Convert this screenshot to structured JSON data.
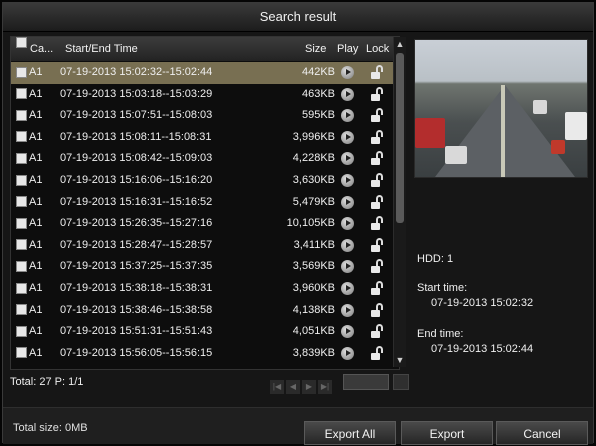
{
  "window": {
    "title": "Search result"
  },
  "table": {
    "columns": {
      "cam": "Ca...",
      "time": "Start/End Time",
      "size": "Size",
      "play": "Play",
      "lock": "Lock"
    },
    "rows": [
      {
        "cam": "A1",
        "time": "07-19-2013 15:02:32--15:02:44",
        "size": "442KB"
      },
      {
        "cam": "A1",
        "time": "07-19-2013 15:03:18--15:03:29",
        "size": "463KB"
      },
      {
        "cam": "A1",
        "time": "07-19-2013 15:07:51--15:08:03",
        "size": "595KB"
      },
      {
        "cam": "A1",
        "time": "07-19-2013 15:08:11--15:08:31",
        "size": "3,996KB"
      },
      {
        "cam": "A1",
        "time": "07-19-2013 15:08:42--15:09:03",
        "size": "4,228KB"
      },
      {
        "cam": "A1",
        "time": "07-19-2013 15:16:06--15:16:20",
        "size": "3,630KB"
      },
      {
        "cam": "A1",
        "time": "07-19-2013 15:16:31--15:16:52",
        "size": "5,479KB"
      },
      {
        "cam": "A1",
        "time": "07-19-2013 15:26:35--15:27:16",
        "size": "10,105KB"
      },
      {
        "cam": "A1",
        "time": "07-19-2013 15:28:47--15:28:57",
        "size": "3,411KB"
      },
      {
        "cam": "A1",
        "time": "07-19-2013 15:37:25--15:37:35",
        "size": "3,569KB"
      },
      {
        "cam": "A1",
        "time": "07-19-2013 15:38:18--15:38:31",
        "size": "3,960KB"
      },
      {
        "cam": "A1",
        "time": "07-19-2013 15:38:46--15:38:58",
        "size": "4,138KB"
      },
      {
        "cam": "A1",
        "time": "07-19-2013 15:51:31--15:51:43",
        "size": "4,051KB"
      },
      {
        "cam": "A1",
        "time": "07-19-2013 15:56:05--15:56:15",
        "size": "3,839KB"
      }
    ],
    "selected_index": 0
  },
  "footer": {
    "total": "Total: 27  P: 1/1"
  },
  "info": {
    "hdd": "HDD: 1",
    "start_label": "Start time:",
    "start_value": "07-19-2013 15:02:32",
    "end_label": "End time:",
    "end_value": "07-19-2013 15:02:44"
  },
  "bottom": {
    "total_size": "Total size: 0MB",
    "export_all": "Export All",
    "export": "Export",
    "cancel": "Cancel"
  }
}
